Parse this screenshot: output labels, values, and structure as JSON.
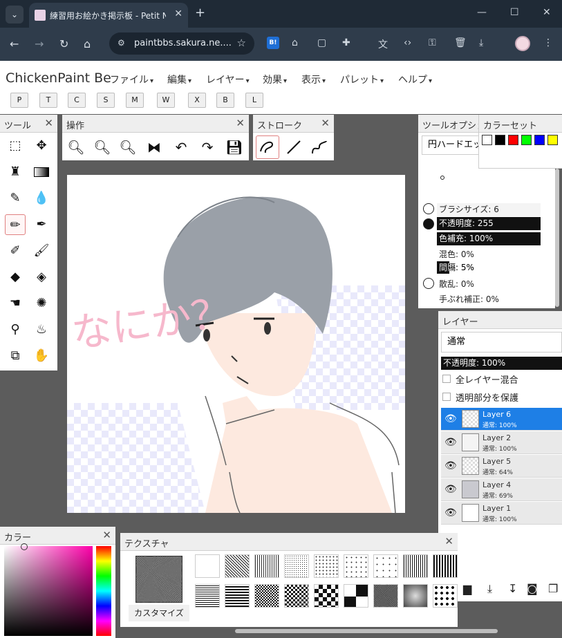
{
  "browser": {
    "tab_title": "練習用お絵かき掲示板 - Petit Note",
    "url": "paintbbs.sakura.ne....",
    "ext_badge": "B!"
  },
  "app": {
    "title": "ChickenPaint Be",
    "menus": [
      "ファイル",
      "編集",
      "レイヤー",
      "効果",
      "表示",
      "パレット",
      "ヘルプ"
    ],
    "shortcut_buttons": [
      "P",
      "T",
      "C",
      "S",
      "M",
      "W",
      "X",
      "B",
      "L"
    ]
  },
  "tools_panel": {
    "title": "ツール"
  },
  "operations_panel": {
    "title": "操作"
  },
  "stroke_panel": {
    "title": "ストローク"
  },
  "tool_options": {
    "title": "ツールオプション",
    "brush_select": "円ハードエッジ",
    "brush_size": "ブラシサイズ: 6",
    "opacity": "不透明度: 255",
    "color_fill": "色補充: 100%",
    "mix": "混色: 0%",
    "spacing": "間隔: 5%",
    "scatter": "散乱: 0%",
    "smoothing": "手ぶれ補正: 0%"
  },
  "color_set": {
    "title": "カラーセット",
    "colors": [
      "#ffffff",
      "#000000",
      "#ff0000",
      "#00ff00",
      "#0000ff",
      "#ffff00"
    ]
  },
  "layers": {
    "title": "レイヤー",
    "blend_mode": "通常",
    "opacity": "不透明度: 100%",
    "merge_all_label": "全レイヤー混合",
    "protect_alpha_label": "透明部分を保護",
    "items": [
      {
        "name": "Layer 6",
        "info": "通常: 100%",
        "selected": true
      },
      {
        "name": "Layer 2",
        "info": "通常: 100%",
        "selected": false
      },
      {
        "name": "Layer 5",
        "info": "通常: 64%",
        "selected": false
      },
      {
        "name": "Layer 4",
        "info": "通常: 69%",
        "selected": false
      },
      {
        "name": "Layer 1",
        "info": "通常: 100%",
        "selected": false
      }
    ]
  },
  "color_panel": {
    "title": "カラー"
  },
  "texture_panel": {
    "title": "テクスチャ",
    "customize_label": "カスタマイズ"
  },
  "canvas_text": "なにか？"
}
